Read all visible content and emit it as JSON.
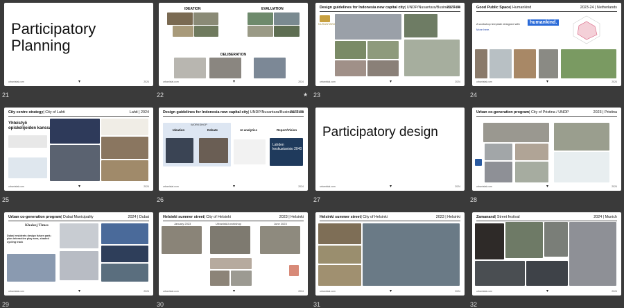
{
  "slides": [
    {
      "number": "21",
      "title": "Participatory\nPlanning"
    },
    {
      "number": "22",
      "labels": [
        "IDEATION",
        "EVALUATION",
        "DELIBERATION"
      ]
    },
    {
      "number": "23",
      "heading": "Design guidelines for Indonesia new capital city",
      "sub": "| UNDP/Nusantara/Business Finland",
      "year": "2023-24",
      "logo_text": "NUSANTARA"
    },
    {
      "number": "24",
      "heading": "Good Public Space",
      "sub": "| Humankind",
      "year": "2023-24 | Netherlands",
      "body": "A workshop template designed with",
      "link": "More here.",
      "brand": "humankind."
    },
    {
      "number": "25",
      "heading": "City centre strategy",
      "sub": "| City of Lahti",
      "year": "Lahti | 2024",
      "big_text": "Yhteistyö\nopiskelijoiden kanssa"
    },
    {
      "number": "26",
      "heading": "Design guidelines for Indonesia new capital city",
      "sub": "| UNDP/Nusantara/Business Finland",
      "year": "2023-24",
      "workshop": "WORKSHOP",
      "ideation": "Ideation",
      "debate": "Debate",
      "ai": "AI analytics",
      "report": "Report/Vision",
      "vision": "Lahden\nkeskustavisio 2040"
    },
    {
      "number": "27",
      "title": "Participatory design"
    },
    {
      "number": "28",
      "heading": "Urban co-generation program",
      "sub": "| City of Pristina / UNDP",
      "year": "2023 | Pristina"
    },
    {
      "number": "29",
      "heading": "Urban co-generation program",
      "sub": "| Dubai Municipality",
      "year": "2024 | Dubai",
      "news_brand": "Khaleej Times",
      "news_head": "Dubai residents design future park; plan interactive play area, shaded cycling track"
    },
    {
      "number": "30",
      "heading": "Helsinki summer street",
      "sub": "| City of Helsinki",
      "year": "2023 | Helsinki",
      "jan": "January 2023",
      "workshop": "UrbanistAI workshop",
      "june": "June 2023"
    },
    {
      "number": "31",
      "heading": "Helsinki summer street",
      "sub": "| City of Helsinki",
      "year": "2023 | Helsinki"
    },
    {
      "number": "32",
      "heading": "Zamanand",
      "sub": "| Street festival",
      "year": "2024 | Munich"
    }
  ],
  "footer_left": "urbanistai.com",
  "footer_right": "2024",
  "starred_slide": "22"
}
